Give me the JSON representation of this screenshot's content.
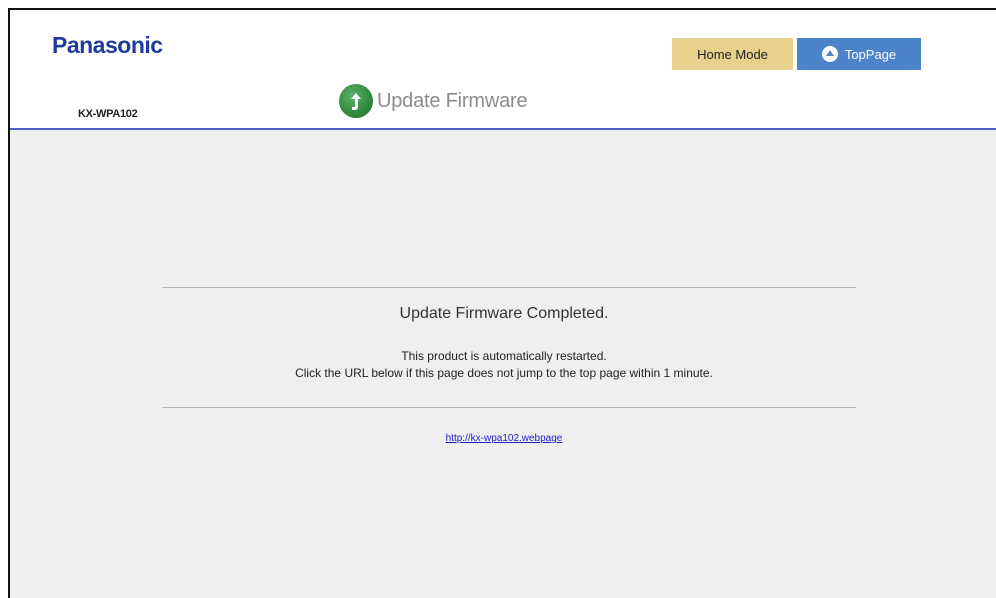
{
  "header": {
    "brand": "Panasonic",
    "model": "KX-WPA102",
    "page_title": "Update Firmware",
    "home_mode_label": "Home Mode",
    "toppage_label": "TopPage"
  },
  "icons": {
    "update": "update-arrow-icon",
    "toppage": "up-arrow-circle-icon"
  },
  "colors": {
    "brand_blue": "#1f3b9c",
    "header_rule": "#4f5fc4",
    "home_mode_bg": "#e7cf8c",
    "toppage_bg": "#4d84c9",
    "update_icon_green": "#2f8a3c",
    "link": "#2020c8"
  },
  "main": {
    "completed_title": "Update Firmware Completed.",
    "message_line1": "This product is automatically restarted.",
    "message_line2": "Click the URL below if this page does not jump to the top page within 1 minute.",
    "link_text": "http://kx-wpa102.webpage"
  }
}
